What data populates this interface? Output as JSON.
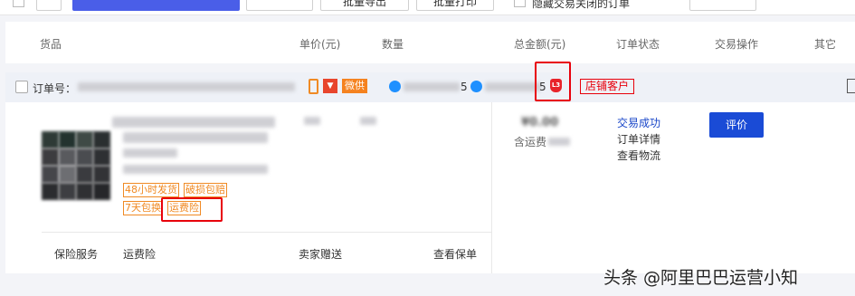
{
  "toolbar": {
    "btn1_label": "",
    "btn1_badge": "",
    "batch_collect": "",
    "batch_export": "批量导出",
    "batch_print": "批量打印",
    "hide_label": "隐藏交易关闭的订单",
    "prev_page": "",
    "page_info": ""
  },
  "header": {
    "columns": [
      "货品",
      "单价(元)",
      "数量",
      "总金额(元)",
      "订单状态",
      "交易操作",
      "其它"
    ]
  },
  "order": {
    "order_no_label": "订单号：",
    "weigong_badge": "微供",
    "wangwang_1_suffix": "5",
    "wangwang_2_suffix": "5",
    "level_badge": "L3",
    "shop_customer_tag": "店铺客户",
    "tags": [
      "48小时发货",
      "破损包赔",
      "7天包换",
      "运费险"
    ],
    "shipping_prefix": "含运费",
    "status": "交易成功",
    "detail_link": "订单详情",
    "logistics_link": "查看物流",
    "rate_button": "评价",
    "services": {
      "insurance_label": "保险服务",
      "insurance_value": "运费险",
      "gift": "卖家赠送",
      "view_policy": "查看保单"
    },
    "colors": {
      "link_blue": "#1a47c9",
      "button_blue": "#1a4bd6",
      "tag_orange": "#f08a24",
      "highlight_red": "#e8000b"
    }
  },
  "watermark": "头条 @阿里巴巴运营小知"
}
